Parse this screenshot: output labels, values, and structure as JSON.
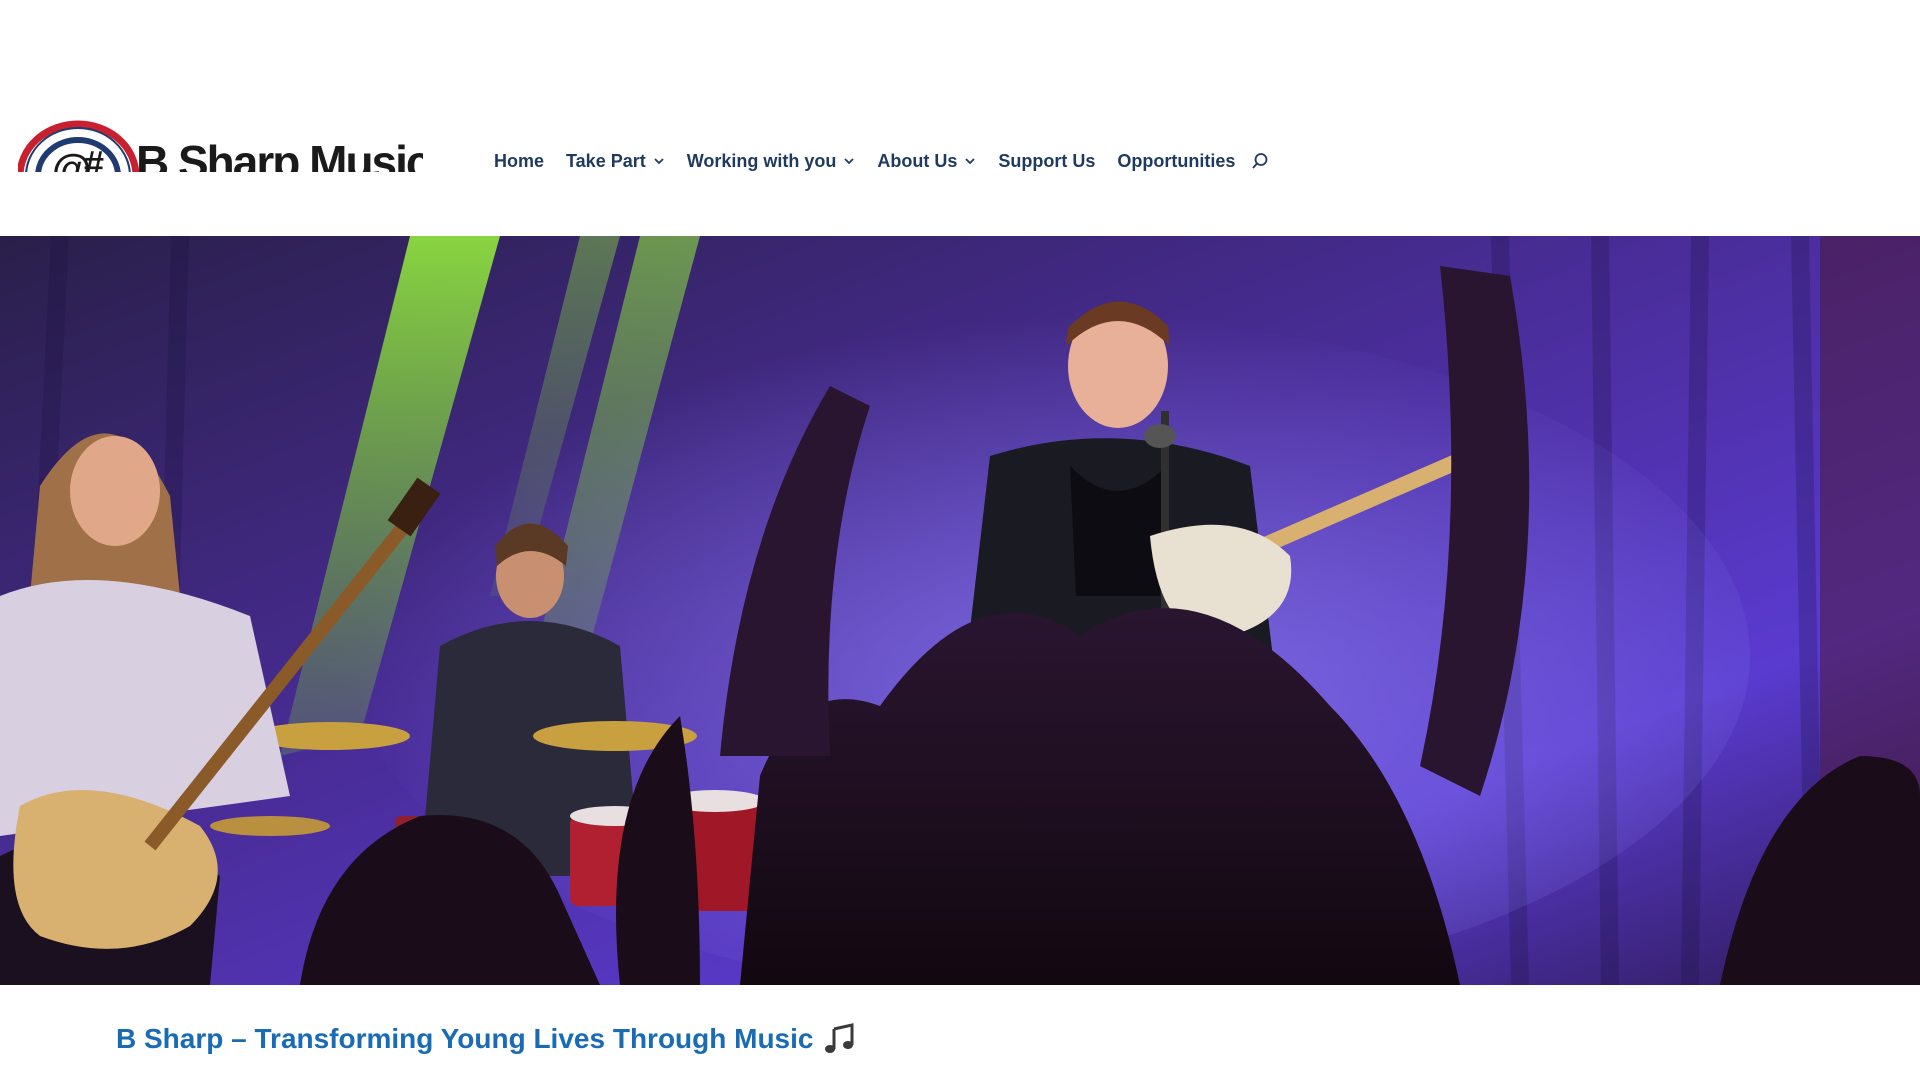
{
  "logo": {
    "text": "B Sharp Music",
    "icon": "logo-mark"
  },
  "nav": {
    "items": [
      {
        "label": "Home",
        "has_dropdown": false
      },
      {
        "label": "Take Part",
        "has_dropdown": true
      },
      {
        "label": "Working with you",
        "has_dropdown": true
      },
      {
        "label": "About Us",
        "has_dropdown": true
      },
      {
        "label": "Support Us",
        "has_dropdown": false
      },
      {
        "label": "Opportunities",
        "has_dropdown": false
      }
    ],
    "search_icon": "search-icon"
  },
  "hero": {
    "icon": "band-concert-photo"
  },
  "main": {
    "heading": "B Sharp – Transforming Young Lives Through Music",
    "heading_icon": "music-note-icon"
  },
  "colors": {
    "nav_text": "#1e3a5f",
    "heading": "#1a6bb5",
    "logo_red": "#c8202f",
    "logo_navy": "#1f3b70"
  }
}
